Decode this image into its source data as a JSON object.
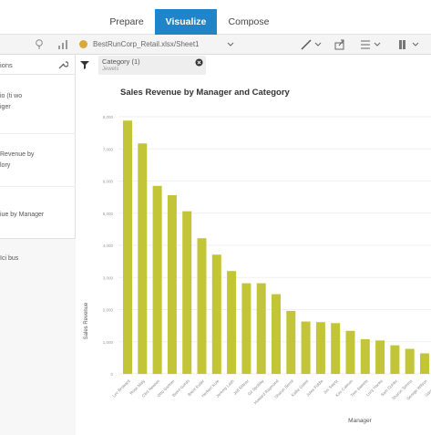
{
  "tabs": {
    "prepare": "Prepare",
    "visualize": "Visualize",
    "compose": "Compose"
  },
  "toolbar": {
    "source_name": "BestRunCorp_Retail.xlsx/Sheet1"
  },
  "left_panel": {
    "title": "ions",
    "items": [
      [
        "io (ti wo",
        "iger"
      ],
      [
        "Revenue by",
        "lory"
      ],
      [
        "iue by Manager"
      ]
    ],
    "footer": "Ici bus"
  },
  "filter": {
    "chip_label": "Category (1)",
    "chip_value": "Jewels"
  },
  "colors": {
    "bar": "#c3c538",
    "accent": "#1f85c8"
  },
  "chart_data": {
    "type": "bar",
    "title": "Sales Revenue by Manager and Category",
    "xlabel": "Manager",
    "ylabel": "Sales Revenue",
    "ylim": [
      0,
      8000
    ],
    "yticks": [
      0,
      1000,
      2000,
      3000,
      4000,
      5000,
      6000,
      7000,
      8000
    ],
    "categories": [
      "Lev Broward",
      "Rose Maly",
      "Clint Newton",
      "Otto Gartner",
      "Brent Gordo",
      "Brent Kulier",
      "Herbert Kule",
      "Jeremy Lash",
      "Jeff Rittner",
      "Gil Spolsky",
      "Howard Raymond",
      "Sharon Bernil",
      "Kallie Gates",
      "Jules Fiddle",
      "Jim Swetz",
      "Kim Colmon",
      "Tom Sweets",
      "Lucy Hanks",
      "Sam Duhler",
      "Sharon Simms",
      "George Wilson",
      "Sarah Kessi",
      "Holt Munroe",
      "Paula Wilde",
      "Chris Rhodes"
    ],
    "values": [
      7880,
      7170,
      5850,
      5560,
      5060,
      4220,
      3710,
      3200,
      2820,
      2820,
      2480,
      1960,
      1630,
      1610,
      1580,
      1340,
      1080,
      1040,
      890,
      780,
      640,
      0,
      0,
      0,
      0
    ]
  }
}
